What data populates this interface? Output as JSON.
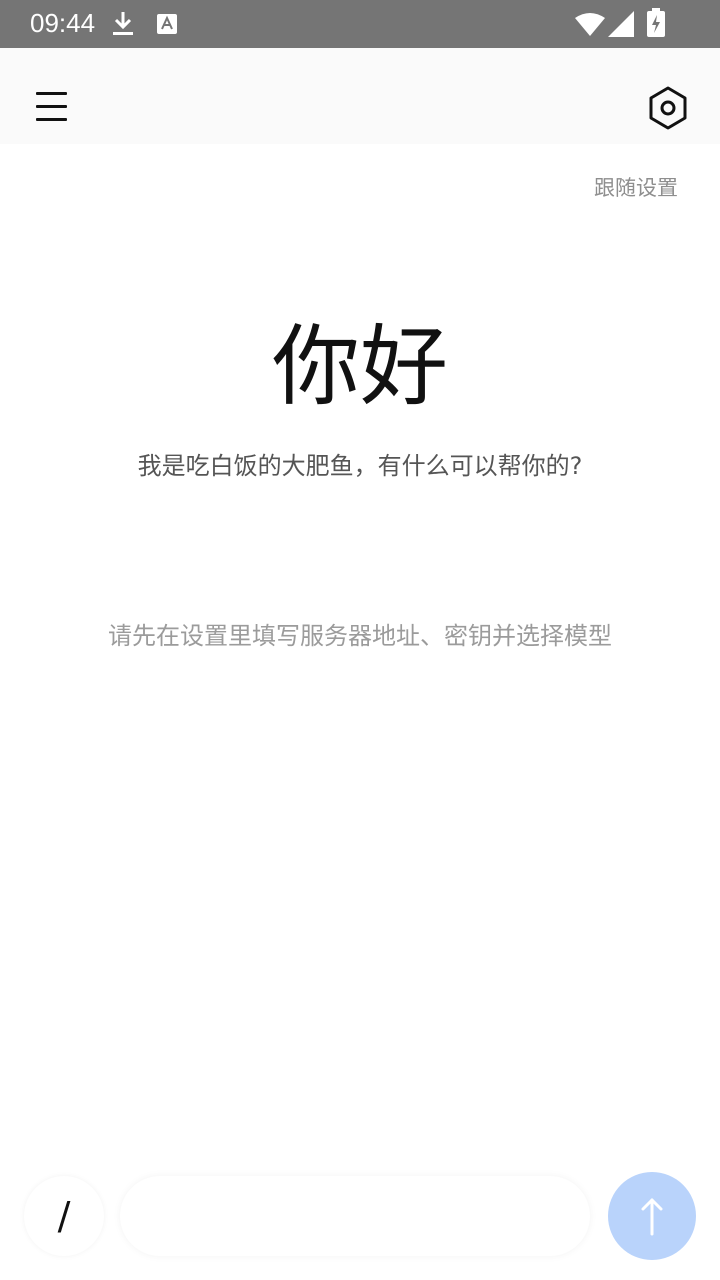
{
  "status_bar": {
    "time": "09:44",
    "icons": [
      "download-icon",
      "keyboard-a-icon",
      "wifi-icon",
      "cell-signal-icon",
      "battery-charging-icon"
    ]
  },
  "app_bar": {
    "menu_icon": "hamburger-menu-icon",
    "settings_icon": "hexagon-settings-icon"
  },
  "main": {
    "follow_settings_label": "跟随设置",
    "greeting_title": "你好",
    "greeting_subtitle": "我是吃白饭的大肥鱼，有什么可以帮你的?",
    "setup_hint": "请先在设置里填写服务器地址、密钥并选择模型"
  },
  "composer": {
    "slash_label": "/",
    "input_value": "",
    "input_placeholder": "",
    "send_icon": "arrow-up-icon"
  },
  "colors": {
    "status_bar_bg": "#757575",
    "send_button_bg": "#b9d3fb",
    "hint_text": "#9b9b9b"
  }
}
